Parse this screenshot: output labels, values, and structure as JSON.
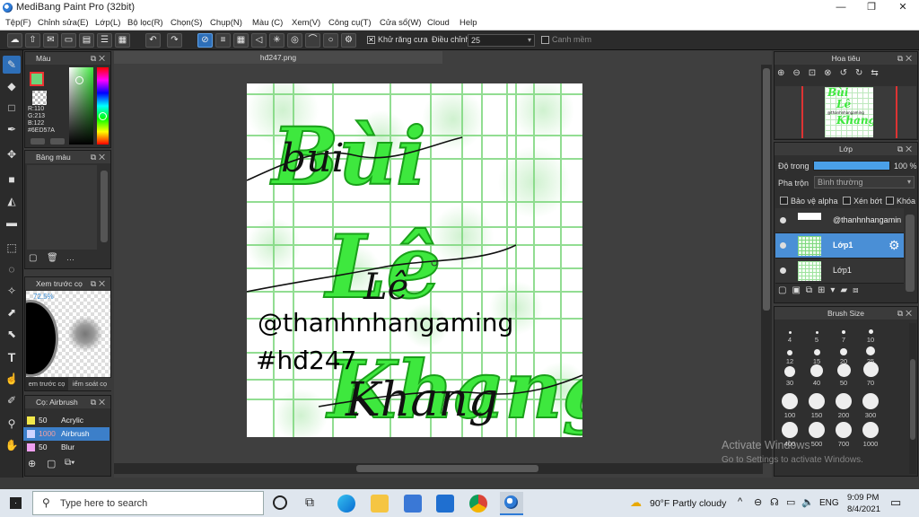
{
  "window": {
    "title": "MediBang Paint Pro (32bit)",
    "min": "—",
    "max": "❐",
    "close": "✕"
  },
  "menu": [
    "Tệp(F)",
    "Chỉnh sửa(E)",
    "Lớp(L)",
    "Bộ lọc(R)",
    "Chọn(S)",
    "Chụp(N)",
    "Màu (C)",
    "Xem(V)",
    "Công cụ(T)",
    "Cửa sổ(W)",
    "Cloud",
    "Help"
  ],
  "toolbar": {
    "antialias_label": "Khử răng cưa",
    "adjust_label": "Điều chỉnh",
    "adjust_value": "25",
    "edge_label": "Canh mềm",
    "antialias_checked": "✕"
  },
  "color_panel": {
    "title": "Màu",
    "r": "R:110",
    "g": "G:213",
    "b": "B:122",
    "hex": "#6ED57A",
    "current": "#6ED57A"
  },
  "palette_panel": {
    "title": "Bảng màu",
    "more": "···"
  },
  "preview_panel": {
    "title": "Xem trước cọ",
    "zoom": "72.5%",
    "tab1": "em trước cọ",
    "tab2": "iểm soát cọ"
  },
  "brush_panel": {
    "title": "Cọ: Airbrush",
    "items": [
      {
        "size": "50",
        "name": "Acrylic",
        "color": "#f2e84a"
      },
      {
        "size": "1000",
        "name": "Airbrush",
        "color": "#cfd4ff"
      },
      {
        "size": "50",
        "name": "Blur",
        "color": "#f0a0f0"
      }
    ]
  },
  "document": {
    "tab": "hđ247.png"
  },
  "artwork": {
    "word1": "Bùi",
    "word2": "Lê",
    "word3": "Khang",
    "script1": "bui",
    "script2": "Lê",
    "script3": "Khang",
    "handle": "@thanhnhangaming",
    "tag": "#hđ247",
    "green": "#3ee83e",
    "grid": "#7fd87f"
  },
  "navigator": {
    "title": "Hoa tiêu",
    "thumb_line1": "Bùi",
    "thumb_line2": "Lê",
    "thumb_line3": "Khang",
    "thumb_handle": "@thanhnhangaming"
  },
  "layers": {
    "title": "Lớp",
    "opacity_label": "Độ trong",
    "opacity_value": "100 %",
    "blend_label": "Pha trộn",
    "blend_value": "Bình thường",
    "protect_alpha": "Bảo vệ alpha",
    "clip": "Xén bớt",
    "lock": "Khóa",
    "items": [
      {
        "name": "@thanhnhangamin"
      },
      {
        "name": "Lớp1",
        "selected": true
      },
      {
        "name": "Lớp1"
      }
    ]
  },
  "brush_size": {
    "title": "Brush Size",
    "rows": [
      [
        "4",
        "5",
        "7",
        "10"
      ],
      [
        "12",
        "15",
        "20",
        "25"
      ],
      [
        "30",
        "40",
        "50",
        "70"
      ],
      [
        "100",
        "150",
        "200",
        "300"
      ],
      [
        "400",
        "500",
        "700",
        "1000"
      ]
    ]
  },
  "watermark": {
    "line1": "Activate Windows",
    "line2": "Go to Settings to activate Windows."
  },
  "taskbar": {
    "search_placeholder": "Type here to search",
    "weather": "90°F  Partly cloudy",
    "lang": "ENG",
    "time": "9:09 PM",
    "date": "8/4/2021"
  }
}
